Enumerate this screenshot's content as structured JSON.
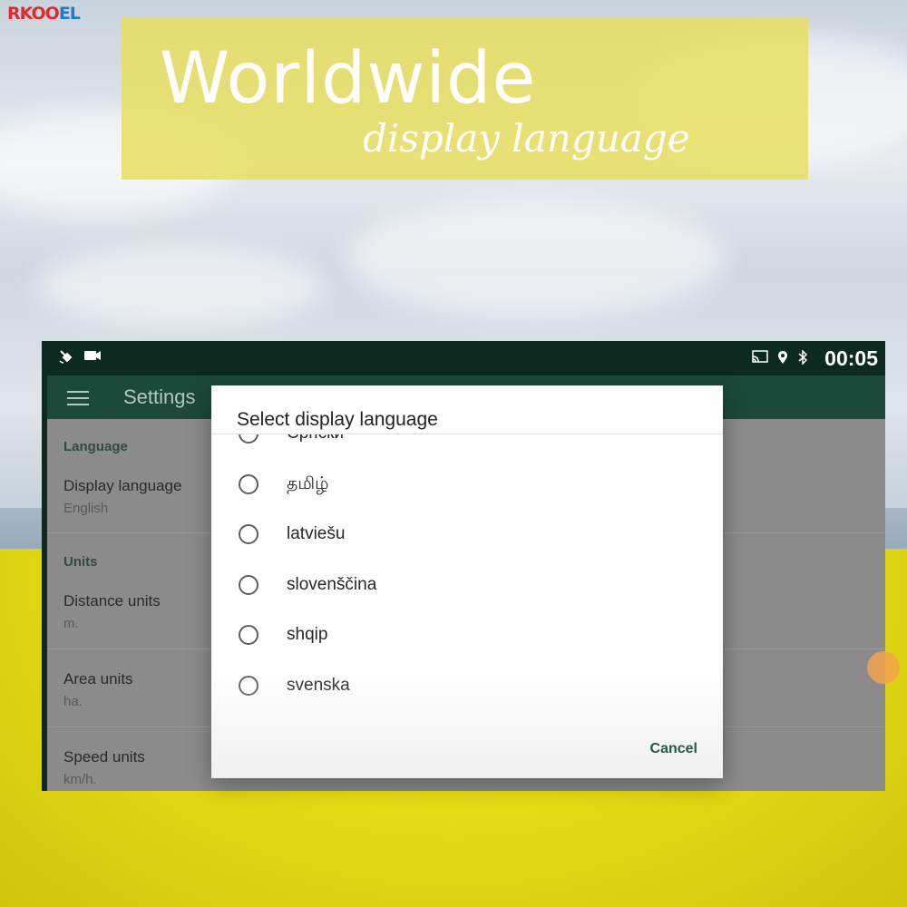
{
  "brand": {
    "part1": "RKOO",
    "part2": "EL"
  },
  "banner": {
    "title": "Worldwide",
    "subtitle": "display language"
  },
  "statusbar": {
    "left_icons": [
      "satellite-icon",
      "camera-icon"
    ],
    "right_icons": [
      "cast-icon",
      "location-icon",
      "bluetooth-icon"
    ],
    "time": "00:05"
  },
  "appbar": {
    "title": "Settings"
  },
  "settings": {
    "language_section": "Language",
    "display_language": {
      "title": "Display language",
      "value": "English"
    },
    "units_section": "Units",
    "distance_units": {
      "title": "Distance units",
      "value": "m."
    },
    "area_units": {
      "title": "Area units",
      "value": "ha."
    },
    "speed_units": {
      "title": "Speed units",
      "value": "km/h."
    }
  },
  "dialog": {
    "title": "Select display language",
    "options": [
      {
        "label": "Српски",
        "selected": false
      },
      {
        "label": "தமிழ்",
        "selected": false
      },
      {
        "label": "latviešu",
        "selected": false
      },
      {
        "label": "slovenščina",
        "selected": false
      },
      {
        "label": "shqip",
        "selected": false
      },
      {
        "label": "svenska",
        "selected": false
      }
    ],
    "cancel_label": "Cancel"
  }
}
